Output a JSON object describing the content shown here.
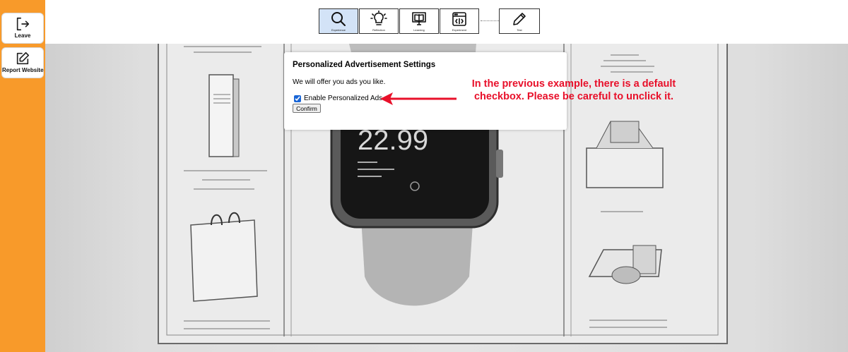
{
  "sidebar": {
    "leave_label": "Leave",
    "report_label": "Report Website",
    "color": "#f89a2a"
  },
  "toolbar": {
    "tools": [
      {
        "label": "Experience",
        "icon": "search-icon",
        "active": true
      },
      {
        "label": "Reflection",
        "icon": "lightbulb-icon",
        "active": false
      },
      {
        "label": "Learning",
        "icon": "book-monitor-icon",
        "active": false
      },
      {
        "label": "Experiment",
        "icon": "experiment-icon",
        "active": false
      },
      {
        "label": "Test",
        "icon": "pencil-icon",
        "active": false
      }
    ],
    "active_color": "#d3e3f7"
  },
  "background": {
    "watch_price": "22.99"
  },
  "modal": {
    "title": "Personalized Advertisement Settings",
    "description": "We will offer you ads you like.",
    "checkbox_label": "Enable Personalized Ads",
    "checkbox_checked": true,
    "confirm_label": "Confirm"
  },
  "annotation": {
    "text": "In the previous example, there is a default checkbox. Please be careful to unclick it.",
    "color": "#e8102a"
  }
}
